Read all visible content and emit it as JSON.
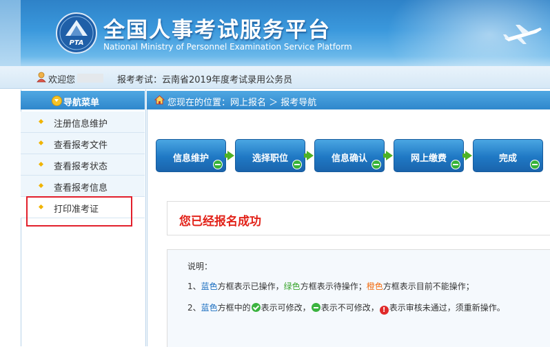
{
  "header": {
    "title_cn": "全国人事考试服务平台",
    "title_en": "National Ministry of Personnel Examination Service Platform",
    "logo_text": "PTA"
  },
  "topbar": {
    "welcome": "欢迎您",
    "exam": "报考考试：云南省2019年度考试录用公务员"
  },
  "sidebar": {
    "header": "导航菜单",
    "items": [
      {
        "label": "注册信息维护"
      },
      {
        "label": "查看报考文件"
      },
      {
        "label": "查看报考状态"
      },
      {
        "label": "查看报考信息"
      },
      {
        "label": "打印准考证"
      }
    ]
  },
  "breadcrumb": {
    "text": "您现在的位置：网上报名 ＞ 报考导航"
  },
  "steps": [
    {
      "label": "信息维护"
    },
    {
      "label": "选择职位"
    },
    {
      "label": "信息确认"
    },
    {
      "label": "网上缴费"
    },
    {
      "label": "完成"
    }
  ],
  "success": "您已经报名成功",
  "notes": {
    "title": "说明：",
    "line1": {
      "prefix": "1、",
      "blue": "蓝色",
      "t1": "方框表示已操作，",
      "green": "绿色",
      "t2": "方框表示待操作；",
      "orange": "橙色",
      "t3": "方框表示目前不能操作；"
    },
    "line2": {
      "prefix": "2、",
      "blue": "蓝色",
      "t1": "方框中的",
      "t2": "表示可修改，",
      "t3": "表示不可修改，",
      "t4": "表示审核未通过，须重新操作。",
      "err_glyph": "!"
    }
  },
  "colors": {
    "accent_blue": "#2f87cc",
    "success_red": "#e2231a",
    "step_blue": "#1f78c4",
    "arrow_green": "#4fb226"
  }
}
